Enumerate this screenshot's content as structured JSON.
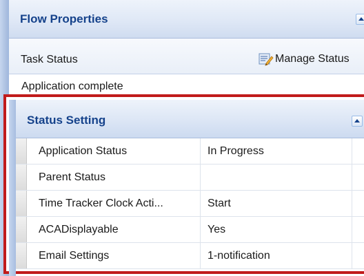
{
  "flow_properties": {
    "title": "Flow Properties"
  },
  "task_status": {
    "label": "Task Status",
    "manage_button_label": "Manage Status",
    "value": "Application complete"
  },
  "status_setting": {
    "title": "Status Setting",
    "rows": [
      {
        "name": "Application Status",
        "value": "In Progress"
      },
      {
        "name": "Parent Status",
        "value": ""
      },
      {
        "name": "Time Tracker Clock Acti...",
        "value": "Start"
      },
      {
        "name": "ACADisplayable",
        "value": "Yes"
      },
      {
        "name": "Email Settings",
        "value": "1-notification"
      }
    ]
  },
  "colors": {
    "header_text": "#15428b",
    "highlight_border": "#c11b1b",
    "rail": "#aec2e2"
  }
}
